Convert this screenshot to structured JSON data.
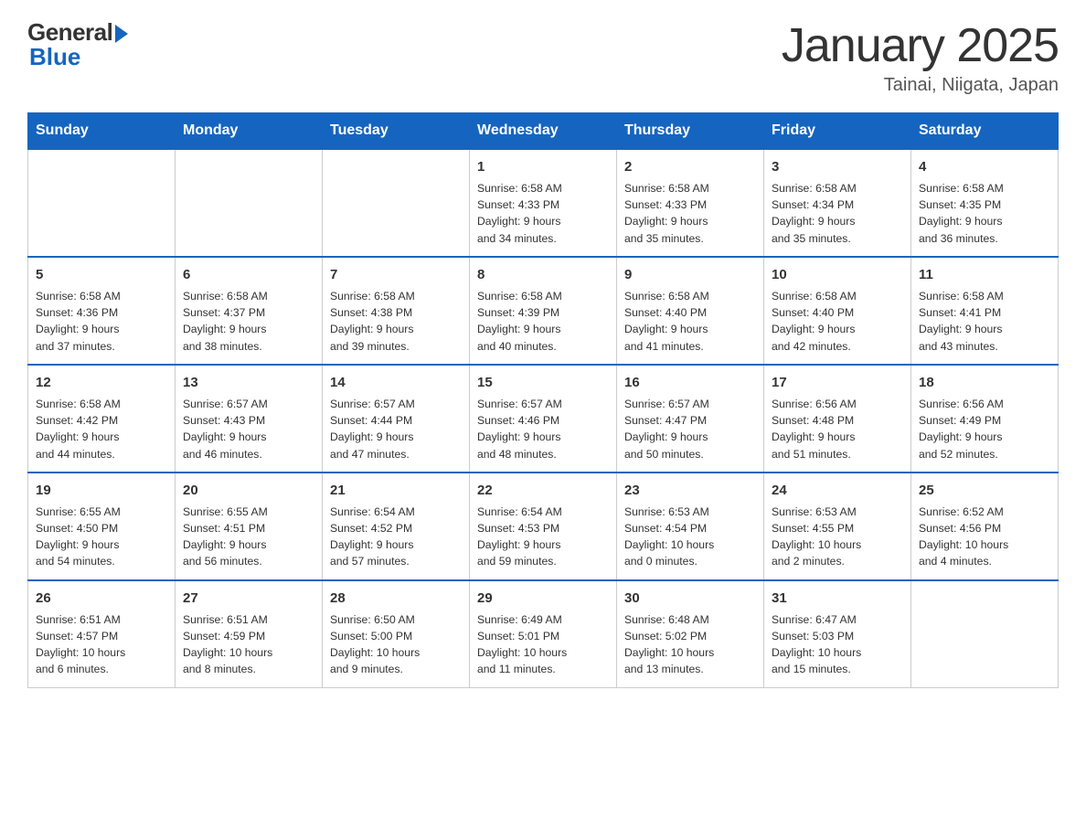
{
  "header": {
    "logo_general": "General",
    "logo_blue": "Blue",
    "title": "January 2025",
    "subtitle": "Tainai, Niigata, Japan"
  },
  "days_of_week": [
    "Sunday",
    "Monday",
    "Tuesday",
    "Wednesday",
    "Thursday",
    "Friday",
    "Saturday"
  ],
  "weeks": [
    [
      {
        "day": "",
        "info": ""
      },
      {
        "day": "",
        "info": ""
      },
      {
        "day": "",
        "info": ""
      },
      {
        "day": "1",
        "info": "Sunrise: 6:58 AM\nSunset: 4:33 PM\nDaylight: 9 hours\nand 34 minutes."
      },
      {
        "day": "2",
        "info": "Sunrise: 6:58 AM\nSunset: 4:33 PM\nDaylight: 9 hours\nand 35 minutes."
      },
      {
        "day": "3",
        "info": "Sunrise: 6:58 AM\nSunset: 4:34 PM\nDaylight: 9 hours\nand 35 minutes."
      },
      {
        "day": "4",
        "info": "Sunrise: 6:58 AM\nSunset: 4:35 PM\nDaylight: 9 hours\nand 36 minutes."
      }
    ],
    [
      {
        "day": "5",
        "info": "Sunrise: 6:58 AM\nSunset: 4:36 PM\nDaylight: 9 hours\nand 37 minutes."
      },
      {
        "day": "6",
        "info": "Sunrise: 6:58 AM\nSunset: 4:37 PM\nDaylight: 9 hours\nand 38 minutes."
      },
      {
        "day": "7",
        "info": "Sunrise: 6:58 AM\nSunset: 4:38 PM\nDaylight: 9 hours\nand 39 minutes."
      },
      {
        "day": "8",
        "info": "Sunrise: 6:58 AM\nSunset: 4:39 PM\nDaylight: 9 hours\nand 40 minutes."
      },
      {
        "day": "9",
        "info": "Sunrise: 6:58 AM\nSunset: 4:40 PM\nDaylight: 9 hours\nand 41 minutes."
      },
      {
        "day": "10",
        "info": "Sunrise: 6:58 AM\nSunset: 4:40 PM\nDaylight: 9 hours\nand 42 minutes."
      },
      {
        "day": "11",
        "info": "Sunrise: 6:58 AM\nSunset: 4:41 PM\nDaylight: 9 hours\nand 43 minutes."
      }
    ],
    [
      {
        "day": "12",
        "info": "Sunrise: 6:58 AM\nSunset: 4:42 PM\nDaylight: 9 hours\nand 44 minutes."
      },
      {
        "day": "13",
        "info": "Sunrise: 6:57 AM\nSunset: 4:43 PM\nDaylight: 9 hours\nand 46 minutes."
      },
      {
        "day": "14",
        "info": "Sunrise: 6:57 AM\nSunset: 4:44 PM\nDaylight: 9 hours\nand 47 minutes."
      },
      {
        "day": "15",
        "info": "Sunrise: 6:57 AM\nSunset: 4:46 PM\nDaylight: 9 hours\nand 48 minutes."
      },
      {
        "day": "16",
        "info": "Sunrise: 6:57 AM\nSunset: 4:47 PM\nDaylight: 9 hours\nand 50 minutes."
      },
      {
        "day": "17",
        "info": "Sunrise: 6:56 AM\nSunset: 4:48 PM\nDaylight: 9 hours\nand 51 minutes."
      },
      {
        "day": "18",
        "info": "Sunrise: 6:56 AM\nSunset: 4:49 PM\nDaylight: 9 hours\nand 52 minutes."
      }
    ],
    [
      {
        "day": "19",
        "info": "Sunrise: 6:55 AM\nSunset: 4:50 PM\nDaylight: 9 hours\nand 54 minutes."
      },
      {
        "day": "20",
        "info": "Sunrise: 6:55 AM\nSunset: 4:51 PM\nDaylight: 9 hours\nand 56 minutes."
      },
      {
        "day": "21",
        "info": "Sunrise: 6:54 AM\nSunset: 4:52 PM\nDaylight: 9 hours\nand 57 minutes."
      },
      {
        "day": "22",
        "info": "Sunrise: 6:54 AM\nSunset: 4:53 PM\nDaylight: 9 hours\nand 59 minutes."
      },
      {
        "day": "23",
        "info": "Sunrise: 6:53 AM\nSunset: 4:54 PM\nDaylight: 10 hours\nand 0 minutes."
      },
      {
        "day": "24",
        "info": "Sunrise: 6:53 AM\nSunset: 4:55 PM\nDaylight: 10 hours\nand 2 minutes."
      },
      {
        "day": "25",
        "info": "Sunrise: 6:52 AM\nSunset: 4:56 PM\nDaylight: 10 hours\nand 4 minutes."
      }
    ],
    [
      {
        "day": "26",
        "info": "Sunrise: 6:51 AM\nSunset: 4:57 PM\nDaylight: 10 hours\nand 6 minutes."
      },
      {
        "day": "27",
        "info": "Sunrise: 6:51 AM\nSunset: 4:59 PM\nDaylight: 10 hours\nand 8 minutes."
      },
      {
        "day": "28",
        "info": "Sunrise: 6:50 AM\nSunset: 5:00 PM\nDaylight: 10 hours\nand 9 minutes."
      },
      {
        "day": "29",
        "info": "Sunrise: 6:49 AM\nSunset: 5:01 PM\nDaylight: 10 hours\nand 11 minutes."
      },
      {
        "day": "30",
        "info": "Sunrise: 6:48 AM\nSunset: 5:02 PM\nDaylight: 10 hours\nand 13 minutes."
      },
      {
        "day": "31",
        "info": "Sunrise: 6:47 AM\nSunset: 5:03 PM\nDaylight: 10 hours\nand 15 minutes."
      },
      {
        "day": "",
        "info": ""
      }
    ]
  ]
}
